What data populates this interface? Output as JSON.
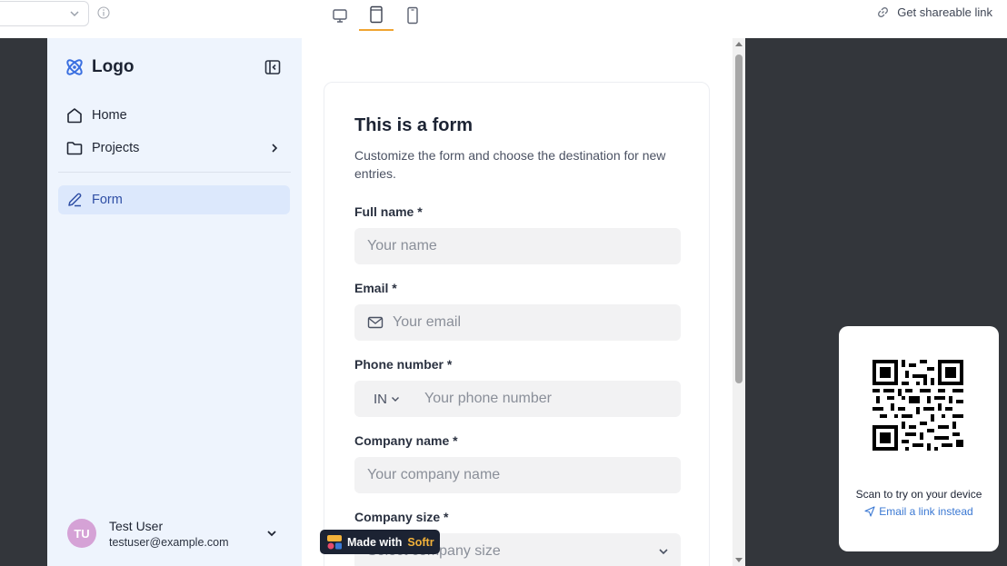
{
  "toolbar": {
    "share_label": "Get shareable link",
    "devices": [
      "desktop-icon",
      "tablet-icon",
      "mobile-icon"
    ],
    "active_device": "tablet",
    "accent": "#f0a431"
  },
  "sidebar": {
    "logo_text": "Logo",
    "items": [
      {
        "label": "Home",
        "icon": "home-icon"
      },
      {
        "label": "Projects",
        "icon": "folder-icon"
      },
      {
        "label": "Form",
        "icon": "pen-icon"
      }
    ],
    "active_item": "Form",
    "user": {
      "initials": "TU",
      "name": "Test User",
      "email": "testuser@example.com"
    }
  },
  "form": {
    "title": "This is a form",
    "description": "Customize the form and choose the destination for new entries.",
    "fields": {
      "full_name": {
        "label": "Full name *",
        "placeholder": "Your name"
      },
      "email": {
        "label": "Email *",
        "placeholder": "Your email"
      },
      "phone": {
        "label": "Phone number *",
        "country": "IN",
        "placeholder": "Your phone number"
      },
      "company_name": {
        "label": "Company name *",
        "placeholder": "Your company name"
      },
      "company_size": {
        "label": "Company size *",
        "placeholder": "Select company size"
      }
    }
  },
  "badge": {
    "prefix": "Made with",
    "brand": "Softr"
  },
  "qr": {
    "caption": "Scan to try on your device",
    "link": "Email a link instead"
  }
}
